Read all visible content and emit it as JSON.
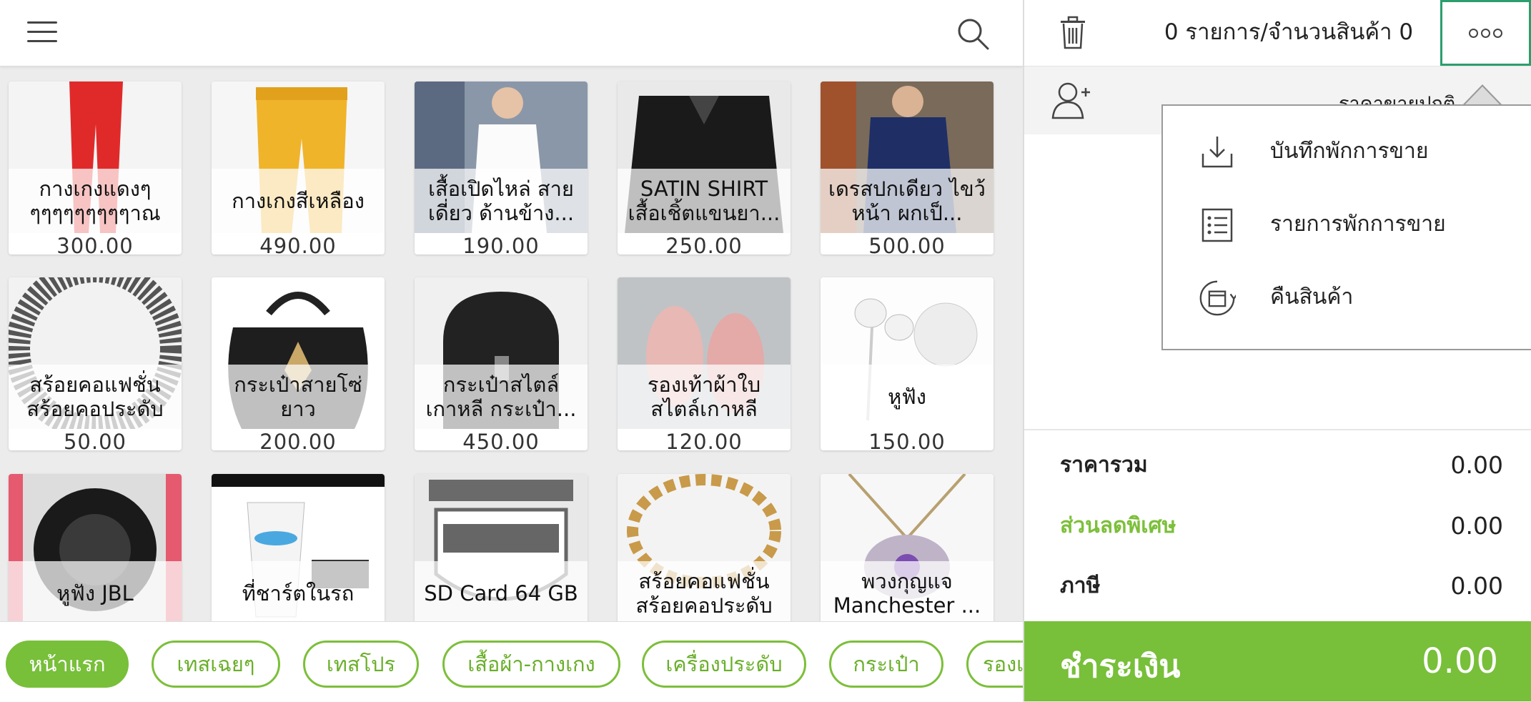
{
  "header": {
    "menu_icon": "hamburger-icon",
    "search_icon": "search-icon"
  },
  "products": [
    {
      "name": "กางเกงแดงๆ ๆๆๆๆๆๆๆๆๆาณ",
      "price": "300.00"
    },
    {
      "name": "กางเกงสีเหลือง",
      "price": "490.00"
    },
    {
      "name": "เสื้อเปิดไหล่ สาย เดี่ยว ด้านข้าง...",
      "price": "190.00"
    },
    {
      "name": "SATIN SHIRT เสื้อเชิ้ตแขนยา...",
      "price": "250.00"
    },
    {
      "name": "เดรสปกเดียว ไขว้หน้า ผกเป็...",
      "price": "500.00"
    },
    {
      "name": "สร้อยคอแฟชั่น สร้อยคอประดับ",
      "price": "50.00"
    },
    {
      "name": "กระเป๋าสายโซ่ ยาว",
      "price": "200.00"
    },
    {
      "name": "กระเป๋าสไตล์ เกาหลี กระเป๋า...",
      "price": "450.00"
    },
    {
      "name": "รองเท้าผ้าใบ สไตล์เกาหลี",
      "price": "120.00"
    },
    {
      "name": "หูฟัง",
      "price": "150.00"
    },
    {
      "name": "หูฟัง JBL",
      "price": ""
    },
    {
      "name": "ที่ชาร์ตในรถ",
      "price": ""
    },
    {
      "name": "SD Card 64 GB",
      "price": ""
    },
    {
      "name": "สร้อยคอแฟชั่น สร้อยคอประดับ",
      "price": ""
    },
    {
      "name": "พวงกุญแจ Manchester ...",
      "price": ""
    }
  ],
  "categories": [
    {
      "label": "หน้าแรก",
      "active": true
    },
    {
      "label": "เทสเฉยๆ",
      "active": false
    },
    {
      "label": "เทสโปร",
      "active": false
    },
    {
      "label": "เสื้อผ้า-กางเกง",
      "active": false
    },
    {
      "label": "เครื่องประดับ",
      "active": false
    },
    {
      "label": "กระเป๋า",
      "active": false
    },
    {
      "label": "รองเท้า",
      "active": false
    }
  ],
  "cart": {
    "count_text": "0 รายการ/จำนวนสินค้า 0",
    "price_type": "ราคาขายปกติ",
    "subtotal_label": "ราคารวม",
    "subtotal": "0.00",
    "discount_label": "ส่วนลดพิเศษ",
    "discount": "0.00",
    "tax_label": "ภาษี",
    "tax": "0.00",
    "pay_label": "ชำระเงิน",
    "pay_total": "0.00"
  },
  "menu": {
    "save_hold": "บันทึกพักการขาย",
    "hold_list": "รายการพักการขาย",
    "return_goods": "คืนสินค้า"
  },
  "colors": {
    "accent": "#78bf3a",
    "highlight_border": "#2b9e6c"
  }
}
